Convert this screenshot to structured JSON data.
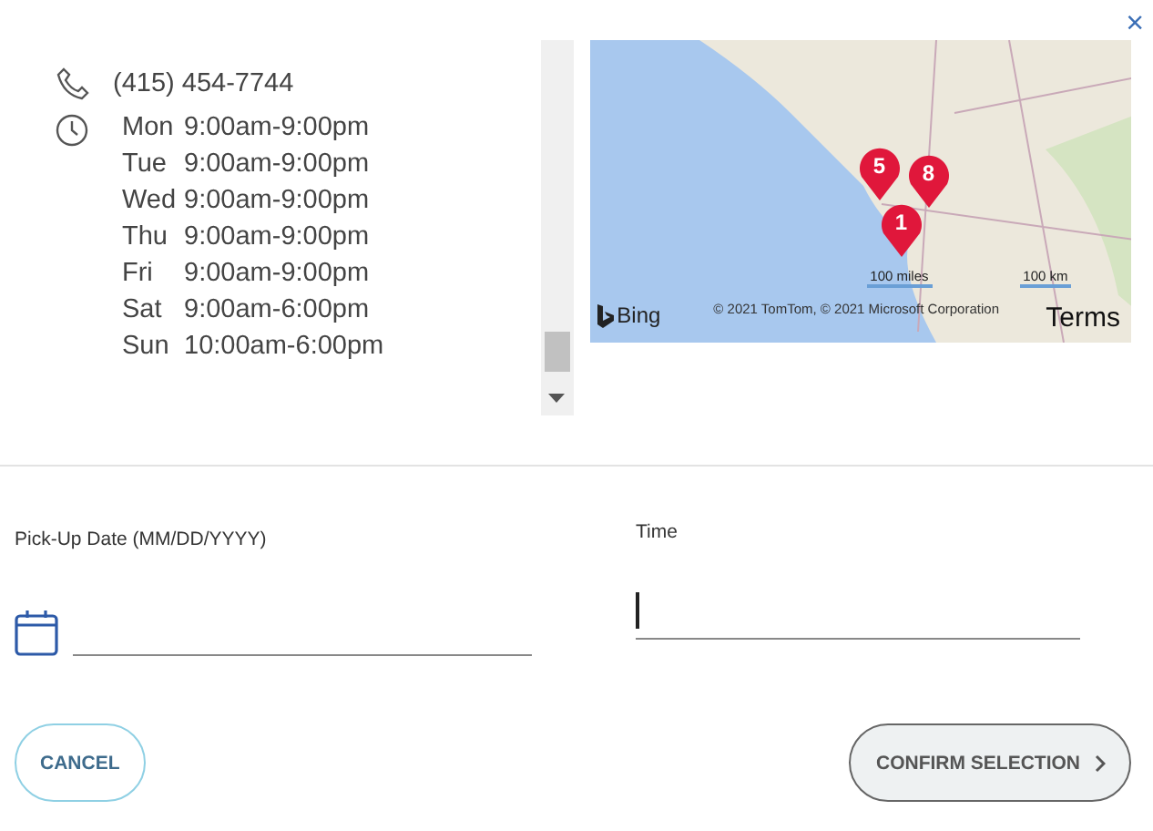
{
  "close_button": {
    "label": "×"
  },
  "store": {
    "phone": "(415) 454-7744",
    "hours": [
      {
        "day": "Mon",
        "time": "9:00am-9:00pm"
      },
      {
        "day": "Tue",
        "time": "9:00am-9:00pm"
      },
      {
        "day": "Wed",
        "time": "9:00am-9:00pm"
      },
      {
        "day": "Thu",
        "time": "9:00am-9:00pm"
      },
      {
        "day": "Fri",
        "time": "9:00am-9:00pm"
      },
      {
        "day": "Sat",
        "time": "9:00am-6:00pm"
      },
      {
        "day": "Sun",
        "time": "10:00am-6:00pm"
      }
    ]
  },
  "map": {
    "pins": [
      {
        "label": "5"
      },
      {
        "label": "8"
      },
      {
        "label": "1"
      }
    ],
    "scale": [
      "100 miles",
      "100 km"
    ],
    "logo": "Bing",
    "copyright": "© 2021 TomTom, © 2021 Microsoft Corporation",
    "terms": "Terms"
  },
  "form": {
    "date": {
      "label": "Pick-Up Date (MM/DD/YYYY)"
    },
    "time": {
      "label": "Time",
      "focused": true
    }
  },
  "buttons": [
    {
      "label": "CANCEL",
      "kind": "secondary"
    },
    {
      "label": "CONFIRM SELECTION",
      "kind": "primary"
    }
  ]
}
